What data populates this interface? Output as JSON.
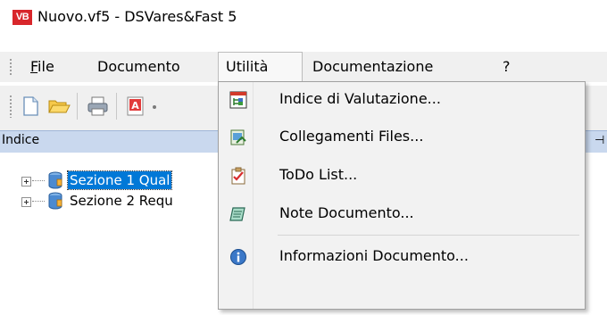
{
  "window": {
    "title": "Nuovo.vf5 - DSVares&Fast 5",
    "logo_text": "VB"
  },
  "menubar": {
    "items": [
      {
        "label": "File",
        "mnemonic": "F",
        "rest": "ile"
      },
      {
        "label": "Documento"
      },
      {
        "label": "Utilità"
      },
      {
        "label": "Documentazione"
      },
      {
        "label": "?"
      }
    ]
  },
  "toolbar": {
    "icons": [
      "new-document-icon",
      "open-folder-icon",
      "print-icon",
      "pdf-export-icon"
    ]
  },
  "panel": {
    "title": "Indice",
    "pin_glyph": "⊣"
  },
  "tree": {
    "items": [
      {
        "label": "Sezione 1 Qual",
        "selected": true
      },
      {
        "label": "Sezione 2 Requ",
        "selected": false
      }
    ]
  },
  "dropdown": {
    "items": [
      {
        "label": "Indice di Valutazione...",
        "icon": "evaluation-index-icon"
      },
      {
        "label": "Collegamenti Files...",
        "icon": "file-links-icon"
      },
      {
        "label": "ToDo List...",
        "icon": "todo-list-icon"
      },
      {
        "label": "Note Documento...",
        "icon": "document-notes-icon"
      },
      {
        "label": "Informazioni Documento...",
        "icon": "info-icon"
      }
    ]
  }
}
